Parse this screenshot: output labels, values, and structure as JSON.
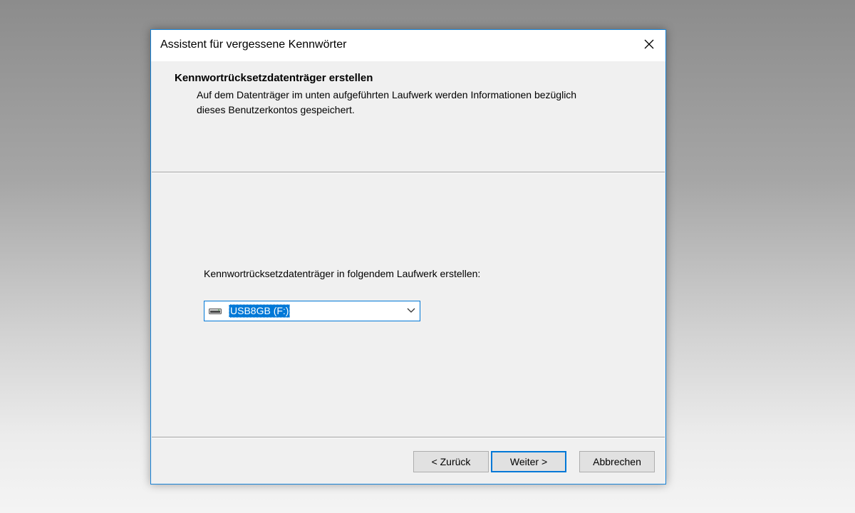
{
  "window": {
    "title": "Assistent für vergessene Kennwörter"
  },
  "header": {
    "title": "Kennwortrücksetzdatenträger erstellen",
    "description": "Auf dem Datenträger im unten aufgeführten Laufwerk werden Informationen bezüglich dieses Benutzerkontos gespeichert."
  },
  "body": {
    "drive_label": "Kennwortrücksetzdatenträger in folgendem Laufwerk erstellen:",
    "drive_select": {
      "selected": "USB8GB (F:)",
      "icon": "usb-drive-icon"
    }
  },
  "buttons": {
    "back": "< Zurück",
    "next": "Weiter >",
    "cancel": "Abbrechen"
  },
  "colors": {
    "accent": "#0078d7",
    "dialog_background": "#f0f0f0"
  }
}
